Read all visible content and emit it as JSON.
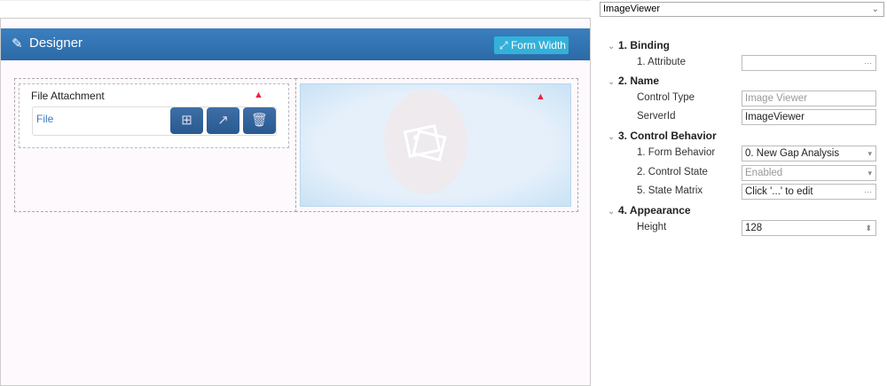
{
  "designer": {
    "title": "Designer",
    "form_width_label": "Form Width",
    "file_attachment": {
      "label": "File Attachment",
      "field": "File",
      "buttons": [
        "add",
        "open",
        "delete"
      ]
    },
    "image_viewer": {
      "icon": "image-icon"
    }
  },
  "properties": {
    "selected_control": "ImageViewer",
    "sections": [
      {
        "title": "1. Binding",
        "rows": [
          {
            "label": "1. Attribute",
            "value": "",
            "suffix": "···"
          }
        ]
      },
      {
        "title": "2. Name",
        "rows": [
          {
            "label": "Control Type",
            "value": "Image Viewer"
          },
          {
            "label": "ServerId",
            "value": "ImageViewer"
          }
        ]
      },
      {
        "title": "3. Control Behavior",
        "rows": [
          {
            "label": "1. Form Behavior",
            "value": "0. New Gap Analysis",
            "suffix": "▾"
          },
          {
            "label": "2. Control State",
            "value": "Enabled",
            "suffix": "▾"
          },
          {
            "label": "5. State Matrix",
            "value": "Click '...' to edit",
            "suffix": "···"
          }
        ]
      },
      {
        "title": "4. Appearance",
        "rows": [
          {
            "label": "Height",
            "value": "128",
            "suffix": "⬍"
          }
        ]
      }
    ]
  },
  "colors": {
    "header": "#2f72b1",
    "accent": "#33b1da",
    "button": "#2e6299"
  }
}
